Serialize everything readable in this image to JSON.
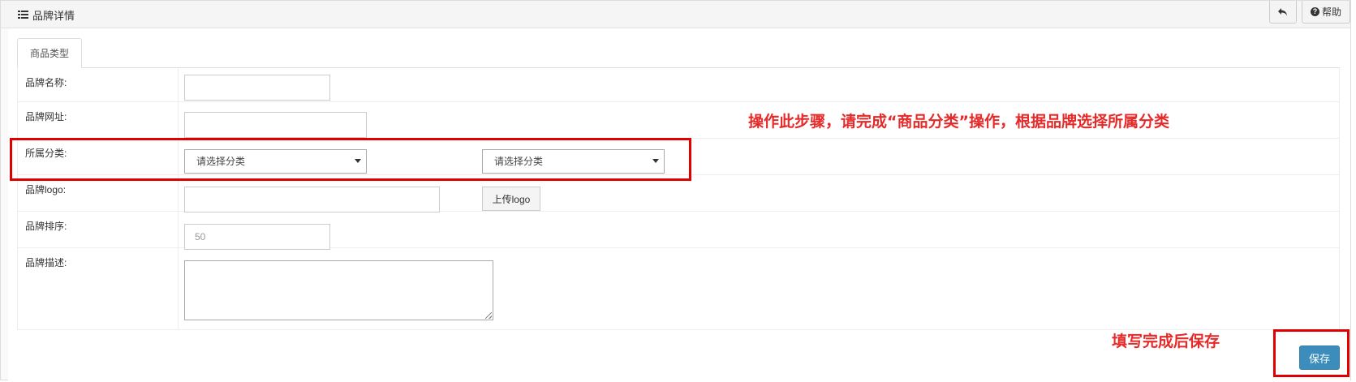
{
  "header": {
    "title": "品牌详情",
    "back_icon": "reply-arrow-icon",
    "help_label": "帮助",
    "help_icon": "question-circle-icon"
  },
  "tabs": [
    {
      "label": "商品类型",
      "active": true
    }
  ],
  "form": {
    "name": {
      "label": "品牌名称:",
      "value": ""
    },
    "url": {
      "label": "品牌网址:",
      "value": ""
    },
    "category": {
      "label": "所属分类:",
      "select1": "请选择分类",
      "select2": "请选择分类"
    },
    "logo": {
      "label": "品牌logo:",
      "value": "",
      "upload_label": "上传logo"
    },
    "sort": {
      "label": "品牌排序:",
      "value": "50"
    },
    "desc": {
      "label": "品牌描述:",
      "value": ""
    }
  },
  "save_label": "保存",
  "annotations": {
    "main": "操作此步骤，请完成“商品分类”操作，根据品牌选择所属分类",
    "save": "填写完成后保存",
    "color": "#e52a2a"
  },
  "colors": {
    "primary_button": "#3c8dbc",
    "highlight_box": "#e10000"
  }
}
